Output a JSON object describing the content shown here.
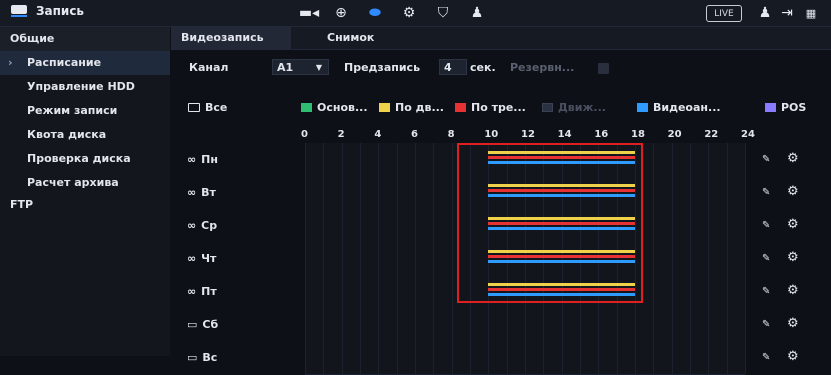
{
  "app": {
    "title": "Запись",
    "live_label": "LIVE"
  },
  "topbar": {
    "icons": [
      "camera-icon",
      "globe-icon",
      "hdd-icon",
      "settings-icon",
      "shield-icon",
      "user-settings-icon",
      "user-icon",
      "logout-icon",
      "grid-icon"
    ]
  },
  "sidebar": {
    "items": [
      {
        "label": "Общие"
      },
      {
        "label": "Расписание"
      },
      {
        "label": "Управление HDD"
      },
      {
        "label": "Режим записи"
      },
      {
        "label": "Квота диска"
      },
      {
        "label": "Проверка диска"
      },
      {
        "label": "Расчет архива"
      },
      {
        "label": "FTP"
      }
    ]
  },
  "tabs": [
    {
      "label": "Видеозапись"
    },
    {
      "label": "Снимок"
    }
  ],
  "form": {
    "channel_label": "Канал",
    "channel_value": "A1",
    "prerecord_label": "Предзапись",
    "prerecord_value": "4",
    "seconds_label": "сек.",
    "reserve_label": "Резервн..."
  },
  "legend": {
    "all_label": "Все",
    "items": [
      {
        "label": "Основ...",
        "color": "#2fbf71"
      },
      {
        "label": "По дв...",
        "color": "#f0d24a"
      },
      {
        "label": "По тре...",
        "color": "#e63232"
      },
      {
        "label": "Движ...",
        "color": "#2a3142"
      },
      {
        "label": "Видеоан...",
        "color": "#2f9bff"
      },
      {
        "label": "POS",
        "color": "#8a7cff"
      }
    ]
  },
  "axis": {
    "ticks": [
      "0",
      "2",
      "4",
      "6",
      "8",
      "10",
      "12",
      "14",
      "16",
      "18",
      "20",
      "22",
      "24"
    ]
  },
  "days": [
    {
      "label": "Пн",
      "linked": true,
      "bars": [
        {
          "color": "#f0d24a",
          "start": 10,
          "end": 18
        },
        {
          "color": "#e63232",
          "start": 10,
          "end": 18
        },
        {
          "color": "#2f9bff",
          "start": 10,
          "end": 18
        }
      ]
    },
    {
      "label": "Вт",
      "linked": true,
      "bars": [
        {
          "color": "#f0d24a",
          "start": 10,
          "end": 18
        },
        {
          "color": "#e63232",
          "start": 10,
          "end": 18
        },
        {
          "color": "#2f9bff",
          "start": 10,
          "end": 18
        }
      ]
    },
    {
      "label": "Ср",
      "linked": true,
      "bars": [
        {
          "color": "#f0d24a",
          "start": 10,
          "end": 18
        },
        {
          "color": "#e63232",
          "start": 10,
          "end": 18
        },
        {
          "color": "#2f9bff",
          "start": 10,
          "end": 18
        }
      ]
    },
    {
      "label": "Чт",
      "linked": true,
      "bars": [
        {
          "color": "#f0d24a",
          "start": 10,
          "end": 18
        },
        {
          "color": "#e63232",
          "start": 10,
          "end": 18
        },
        {
          "color": "#2f9bff",
          "start": 10,
          "end": 18
        }
      ]
    },
    {
      "label": "Пт",
      "linked": true,
      "bars": [
        {
          "color": "#f0d24a",
          "start": 10,
          "end": 18
        },
        {
          "color": "#e63232",
          "start": 10,
          "end": 18
        },
        {
          "color": "#2f9bff",
          "start": 10,
          "end": 18
        }
      ]
    },
    {
      "label": "Сб",
      "linked": false,
      "bars": []
    },
    {
      "label": "Вс",
      "linked": false,
      "bars": []
    }
  ],
  "colors": {
    "accent": "#2f8bff",
    "highlight": "#e02020"
  }
}
